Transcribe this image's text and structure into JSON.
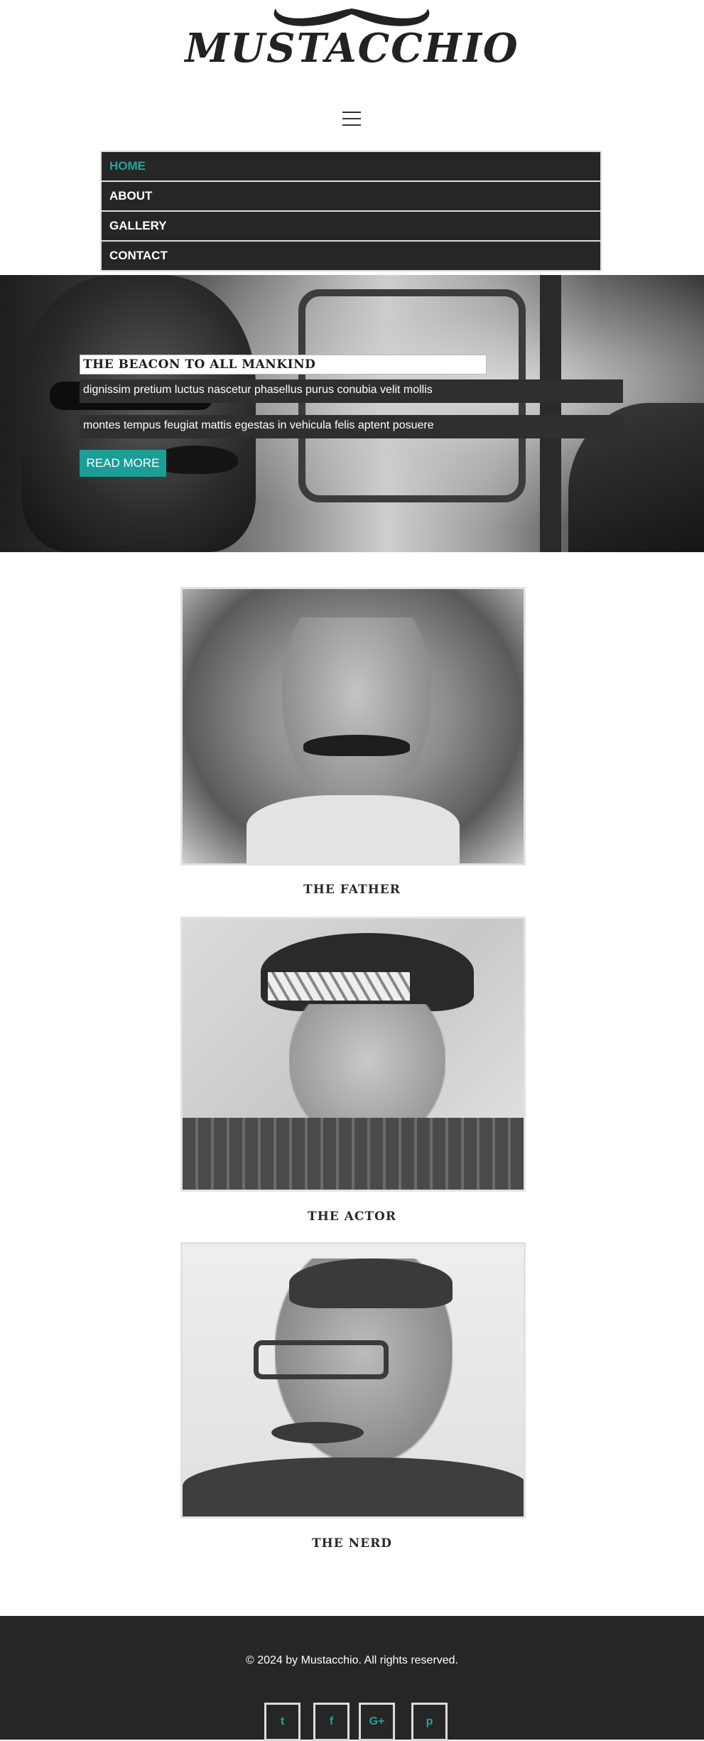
{
  "brand": {
    "logo_text": "MUSTACCHIO",
    "accent_color": "#1fa5a0"
  },
  "header": {
    "menu_icon": "hamburger-menu-icon"
  },
  "nav": {
    "items": [
      {
        "label": "HOME",
        "active": true
      },
      {
        "label": "ABOUT",
        "active": false
      },
      {
        "label": "GALLERY",
        "active": false
      },
      {
        "label": "CONTACT",
        "active": false
      }
    ]
  },
  "hero": {
    "title": "THE BEACON TO ALL MANKIND",
    "line1": "dignissim pretium luctus nascetur phasellus purus conubia velit mollis",
    "line2": "montes tempus feugiat mattis egestas in vehicula felis aptent posuere",
    "button_label": "READ MORE"
  },
  "gallery": {
    "cards": [
      {
        "caption": "THE FATHER"
      },
      {
        "caption": "THE ACTOR"
      },
      {
        "caption": "THE NERD"
      }
    ]
  },
  "footer": {
    "copyright": "© 2024 by Mustacchio. All rights reserved.",
    "social": [
      {
        "icon": "twitter-icon",
        "glyph": "t"
      },
      {
        "icon": "facebook-icon",
        "glyph": "f"
      },
      {
        "icon": "google-plus-icon",
        "glyph": "G+"
      },
      {
        "icon": "pinterest-icon",
        "glyph": "p"
      }
    ]
  }
}
